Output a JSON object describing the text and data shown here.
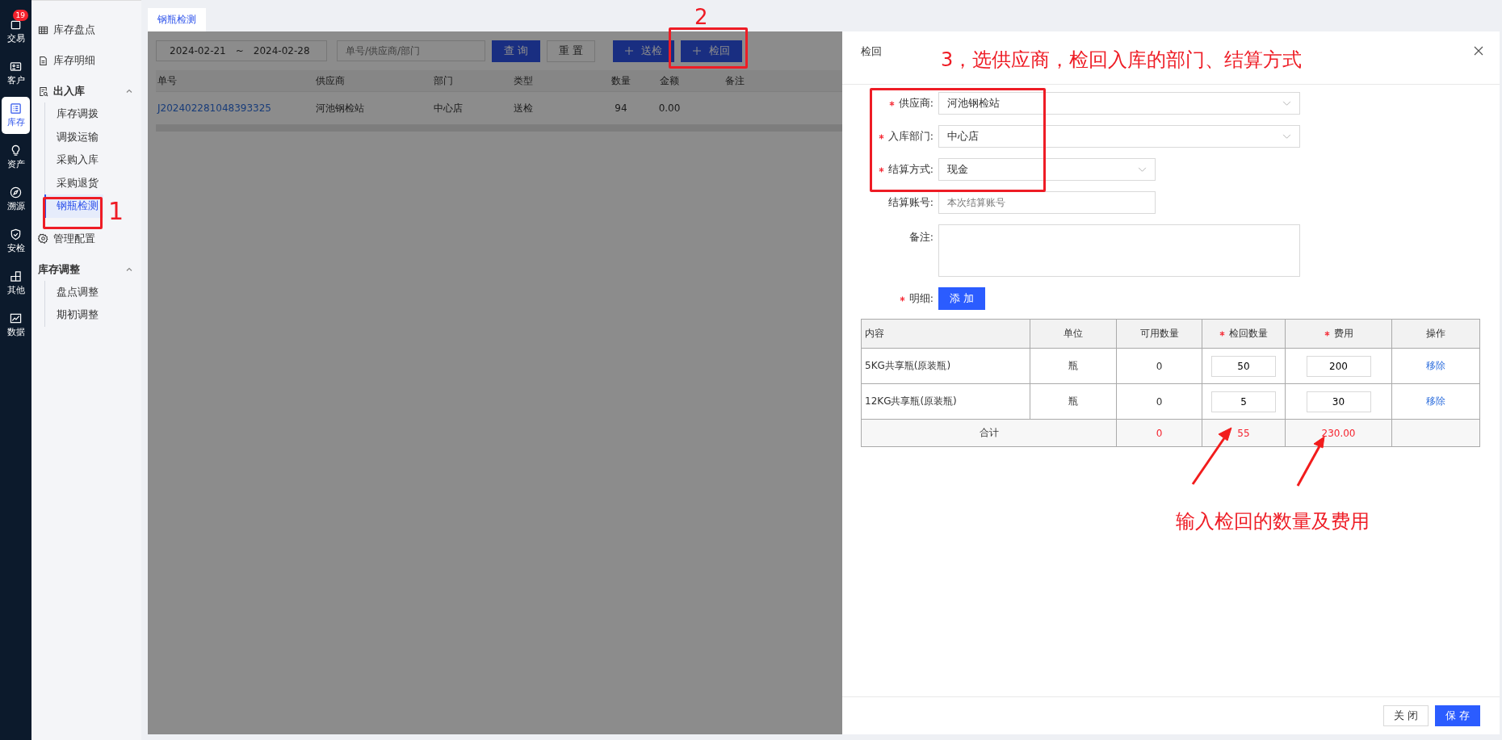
{
  "nav_rail": [
    {
      "label": "交易",
      "badge": "19",
      "selected": false
    },
    {
      "label": "客户",
      "selected": false
    },
    {
      "label": "库存",
      "selected": true
    },
    {
      "label": "资产",
      "selected": false
    },
    {
      "label": "溯源",
      "selected": false
    },
    {
      "label": "安检",
      "selected": false
    },
    {
      "label": "其他",
      "selected": false
    },
    {
      "label": "数据",
      "selected": false
    }
  ],
  "sidebar": {
    "items": [
      {
        "kind": "link",
        "label": "库存盘点",
        "selected": false
      },
      {
        "kind": "link",
        "label": "库存明细",
        "selected": false
      },
      {
        "kind": "group",
        "label": "出入库",
        "expanded": true,
        "children": [
          {
            "label": "库存调拨",
            "selected": false
          },
          {
            "label": "调拨运输",
            "selected": false
          },
          {
            "label": "采购入库",
            "selected": false
          },
          {
            "label": "采购退货",
            "selected": false
          },
          {
            "label": "钢瓶检测",
            "selected": true
          }
        ]
      },
      {
        "kind": "link",
        "label": "管理配置",
        "selected": false
      },
      {
        "kind": "section",
        "label": "库存调整",
        "expanded": true,
        "children": [
          {
            "label": "盘点调整",
            "selected": false
          },
          {
            "label": "期初调整",
            "selected": false
          }
        ]
      }
    ]
  },
  "tabs": [
    {
      "label": "钢瓶检测",
      "selected": true
    }
  ],
  "filters": {
    "date_start": "2024-02-21",
    "date_separator": "~",
    "date_end": "2024-02-28",
    "search_placeholder": "单号/供应商/部门"
  },
  "toolbar_buttons": [
    {
      "label": "查 询",
      "kind": "primary"
    },
    {
      "label": "重 置",
      "kind": "default"
    },
    {
      "label": "送检",
      "kind": "add"
    },
    {
      "label": "检回",
      "kind": "add"
    }
  ],
  "table": {
    "columns": [
      "单号",
      "供应商",
      "部门",
      "类型",
      "数量",
      "金额",
      "备注"
    ],
    "rows": [
      {
        "order_no": "J202402281048393325",
        "supplier": "河池钢检站",
        "department": "中心店",
        "type": "送检",
        "quantity": "94",
        "amount": "0.00"
      }
    ]
  },
  "drawer": {
    "title": "检回",
    "fields": [
      {
        "kind": "select",
        "label": "供应商:",
        "required": true,
        "value": "河池钢检站"
      },
      {
        "kind": "select",
        "label": "入库部门:",
        "required": true,
        "value": "中心店"
      },
      {
        "kind": "select-narrow",
        "label": "结算方式:",
        "required": true,
        "value": "现金"
      },
      {
        "kind": "input-narrow",
        "label": "结算账号:",
        "required": false,
        "placeholder": "本次结算账号"
      },
      {
        "kind": "textarea",
        "label": "备注:",
        "required": false
      },
      {
        "kind": "add-button",
        "label": "明细:",
        "required": true,
        "button": "添 加"
      }
    ],
    "detail_table": {
      "columns": [
        {
          "label": "内容",
          "required": false
        },
        {
          "label": "单位",
          "required": false
        },
        {
          "label": "可用数量",
          "required": false
        },
        {
          "label": "检回数量",
          "required": true
        },
        {
          "label": "费用",
          "required": true
        },
        {
          "label": "操作",
          "required": false
        }
      ],
      "rows": [
        {
          "content": "5KG共享瓶(原装瓶)",
          "unit": "瓶",
          "available": "0",
          "return_qty": "50",
          "fee": "200",
          "action": "移除"
        },
        {
          "content": "12KG共享瓶(原装瓶)",
          "unit": "瓶",
          "available": "0",
          "return_qty": "5",
          "fee": "30",
          "action": "移除"
        }
      ],
      "totals": {
        "label": "合计",
        "available": "0",
        "return_qty": "55",
        "fee": "230.00"
      }
    },
    "footer_buttons": [
      {
        "label": "关 闭",
        "kind": "default"
      },
      {
        "label": "保 存",
        "kind": "primary"
      }
    ]
  },
  "annotations": {
    "step_1": "1",
    "step_2": "2",
    "step_3": "3，选供应商，检回入库的部门、结算方式",
    "note": "输入检回的数量及费用"
  }
}
